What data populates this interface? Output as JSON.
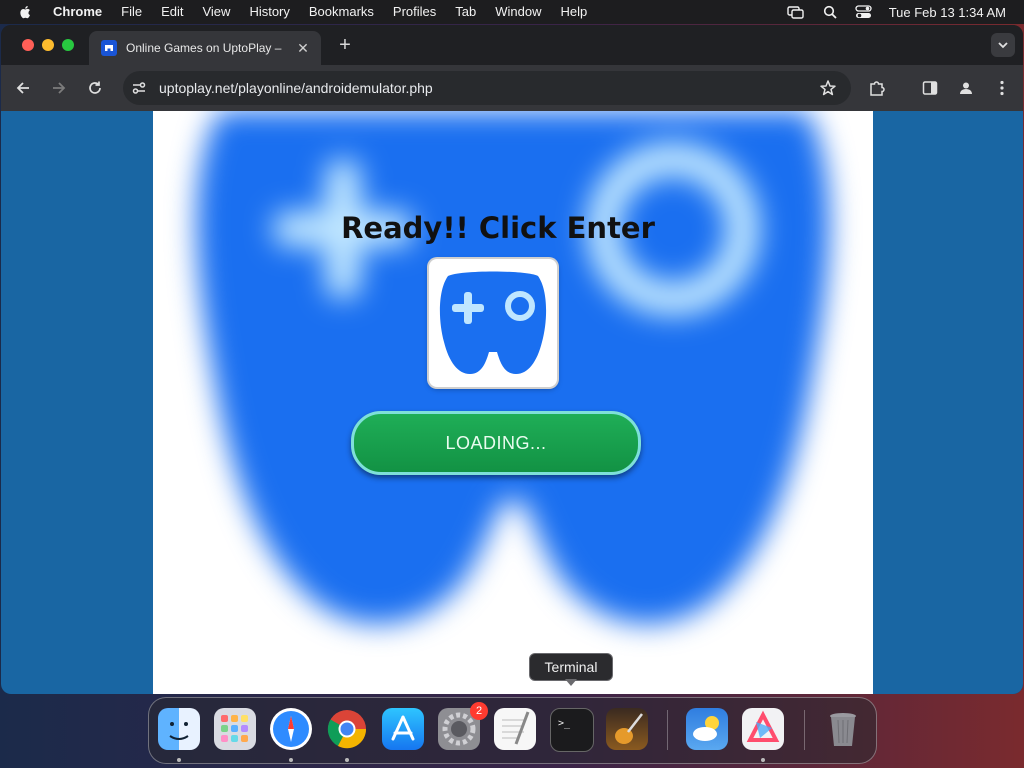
{
  "menubar": {
    "app_name": "Chrome",
    "items": [
      "File",
      "Edit",
      "View",
      "History",
      "Bookmarks",
      "Profiles",
      "Tab",
      "Window",
      "Help"
    ],
    "clock": "Tue Feb 13  1:34 AM",
    "status_icons": [
      "screen-mirroring-icon",
      "search-icon",
      "control-center-icon"
    ]
  },
  "browser": {
    "tab": {
      "title": "Online Games on UptoPlay –",
      "favicon": "uptoplay-icon"
    },
    "url": "uptoplay.net/playonline/androidemulator.php"
  },
  "page": {
    "ready_text": "Ready!! Click Enter",
    "loading_label": "LOADING...",
    "colors": {
      "logo_blue": "#1a6ff0",
      "button_green": "#1aa350",
      "page_background": "#1966a3"
    }
  },
  "dock": {
    "tooltip": "Terminal",
    "badge_count": "2",
    "apps": [
      "Finder",
      "Launchpad",
      "Safari",
      "Chrome",
      "App Store",
      "System Settings",
      "TextEdit",
      "Terminal",
      "GarageBand",
      "Weather",
      "Affinity",
      "Trash"
    ]
  }
}
